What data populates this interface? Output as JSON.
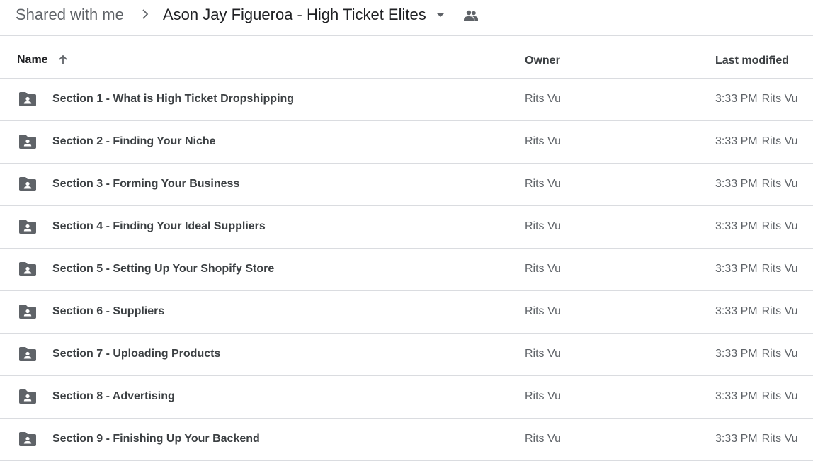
{
  "breadcrumb": {
    "root": "Shared with me",
    "separator_icon": "chevron-right-icon",
    "current": "Ason Jay Figueroa - High Ticket Elites",
    "dropdown_icon": "arrow-drop-down-icon",
    "shared_icon": "people-icon"
  },
  "table": {
    "columns": {
      "name": "Name",
      "owner": "Owner",
      "last_modified": "Last modified"
    },
    "sort": {
      "column": "name",
      "direction": "ascending",
      "icon": "arrow-up-icon"
    },
    "rows": [
      {
        "icon": "shared-folder-icon",
        "name": "Section 1 - What is High Ticket Dropshipping",
        "owner": "Rits Vu",
        "modified": "3:33 PM",
        "modified_by": "Rits Vu"
      },
      {
        "icon": "shared-folder-icon",
        "name": "Section 2 - Finding Your Niche",
        "owner": "Rits Vu",
        "modified": "3:33 PM",
        "modified_by": "Rits Vu"
      },
      {
        "icon": "shared-folder-icon",
        "name": "Section 3 - Forming Your Business",
        "owner": "Rits Vu",
        "modified": "3:33 PM",
        "modified_by": "Rits Vu"
      },
      {
        "icon": "shared-folder-icon",
        "name": "Section 4 - Finding Your Ideal Suppliers",
        "owner": "Rits Vu",
        "modified": "3:33 PM",
        "modified_by": "Rits Vu"
      },
      {
        "icon": "shared-folder-icon",
        "name": "Section 5 - Setting Up Your Shopify Store",
        "owner": "Rits Vu",
        "modified": "3:33 PM",
        "modified_by": "Rits Vu"
      },
      {
        "icon": "shared-folder-icon",
        "name": "Section 6 - Suppliers",
        "owner": "Rits Vu",
        "modified": "3:33 PM",
        "modified_by": "Rits Vu"
      },
      {
        "icon": "shared-folder-icon",
        "name": "Section 7 - Uploading Products",
        "owner": "Rits Vu",
        "modified": "3:33 PM",
        "modified_by": "Rits Vu"
      },
      {
        "icon": "shared-folder-icon",
        "name": "Section 8 - Advertising",
        "owner": "Rits Vu",
        "modified": "3:33 PM",
        "modified_by": "Rits Vu"
      },
      {
        "icon": "shared-folder-icon",
        "name": "Section 9 - Finishing Up Your Backend",
        "owner": "Rits Vu",
        "modified": "3:33 PM",
        "modified_by": "Rits Vu"
      }
    ]
  },
  "colors": {
    "icon_gray": "#5f6368",
    "text_dark": "#202124",
    "text_body": "#3c4043",
    "divider": "#dadce0"
  }
}
